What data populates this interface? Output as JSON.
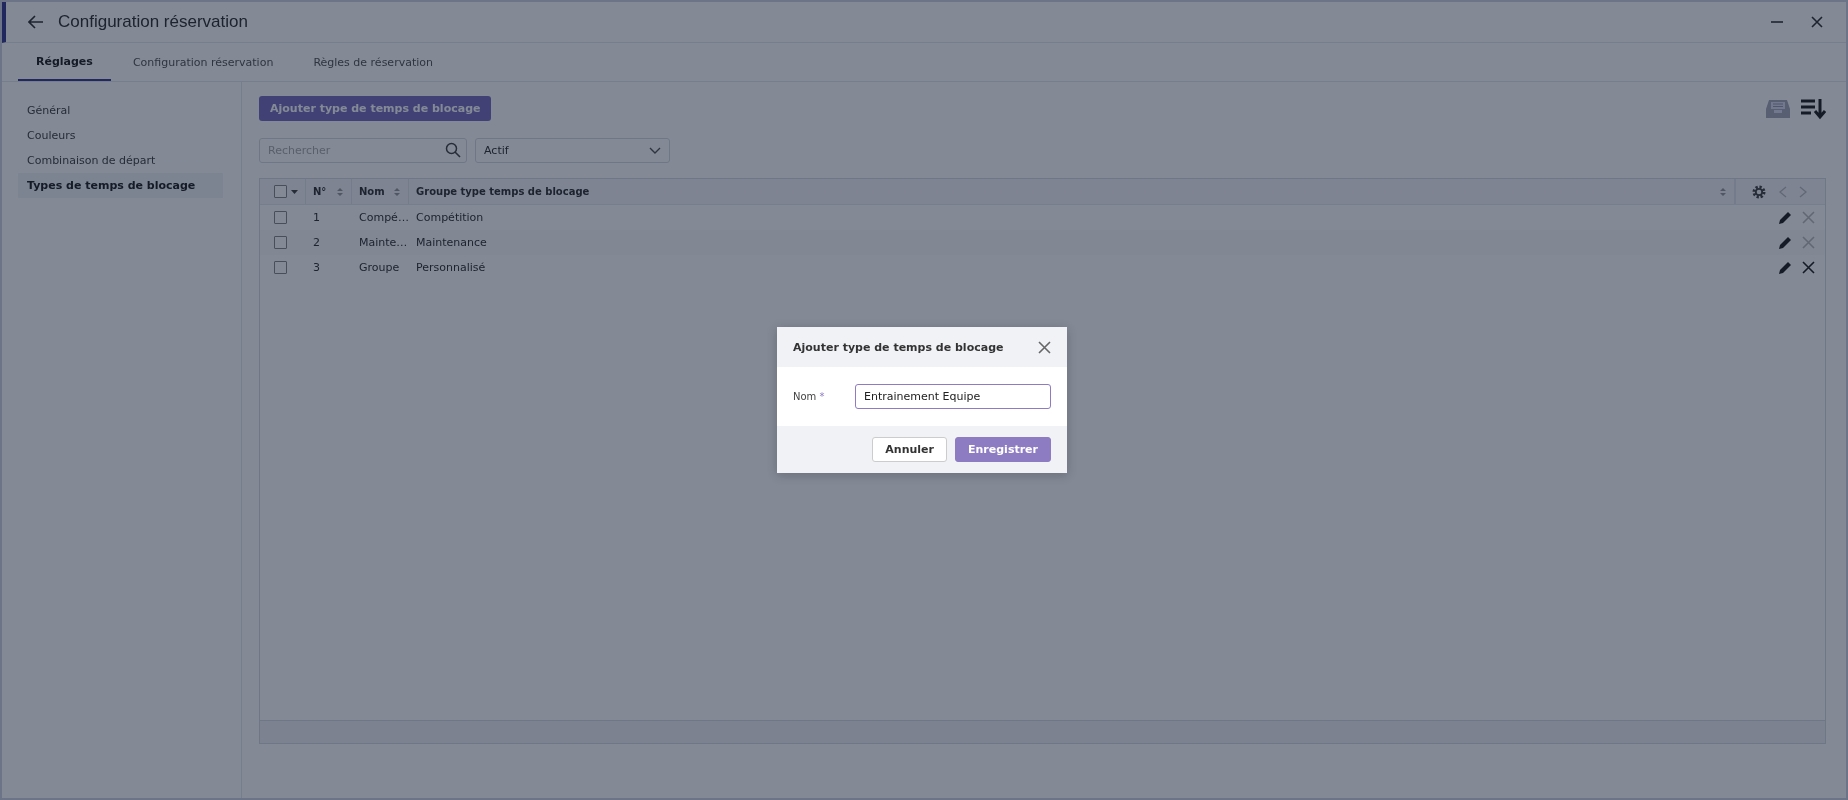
{
  "window": {
    "title": "Configuration réservation"
  },
  "tabs": [
    {
      "label": "Réglages",
      "selected": true
    },
    {
      "label": "Configuration réservation",
      "selected": false
    },
    {
      "label": "Règles de réservation",
      "selected": false
    }
  ],
  "sidebar": {
    "items": [
      {
        "label": "Général",
        "selected": false
      },
      {
        "label": "Couleurs",
        "selected": false
      },
      {
        "label": "Combinaison de départ",
        "selected": false
      },
      {
        "label": "Types de temps de blocage",
        "selected": true
      }
    ]
  },
  "toolbar": {
    "add_button": "Ajouter type de temps de blocage",
    "search": {
      "placeholder": "Rechercher"
    },
    "status_filter": "Actif"
  },
  "table": {
    "select_all_checked": false,
    "columns": [
      "N°",
      "Nom",
      "Groupe type temps de blocage"
    ],
    "rows": [
      {
        "cells": [
          "1",
          "Compé…",
          "Compétition"
        ],
        "checked": false,
        "delete_disabled": true
      },
      {
        "cells": [
          "2",
          "Mainte…",
          "Maintenance"
        ],
        "checked": false,
        "delete_disabled": true
      },
      {
        "cells": [
          "3",
          "Groupe",
          "Personnalisé"
        ],
        "checked": false,
        "delete_disabled": false
      }
    ]
  },
  "dialog": {
    "title": "Ajouter type de temps de blocage",
    "field_label": "Nom",
    "required_mark": "*",
    "field_value": "Entrainement Equipe",
    "buttons": [
      "Annuler",
      "Enregistrer"
    ]
  }
}
